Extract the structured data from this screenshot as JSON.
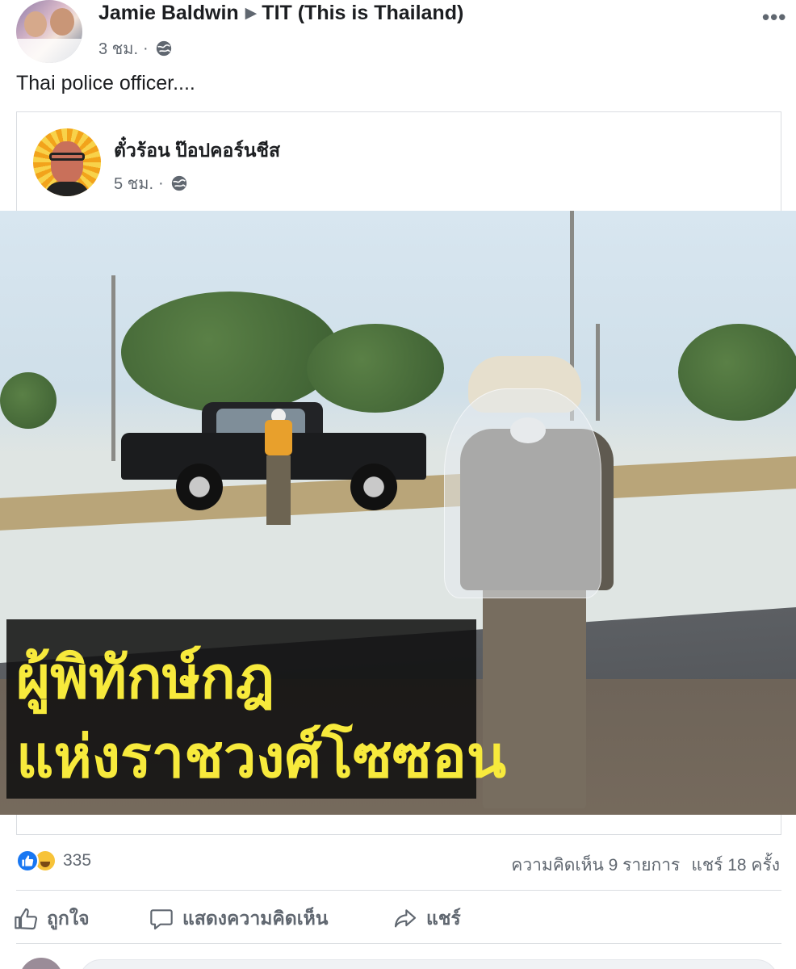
{
  "post": {
    "author": "Jamie Baldwin",
    "group": "TIT (This is Thailand)",
    "time": "3 ชม.",
    "separator": "·",
    "more_icon": "ellipsis-icon",
    "text": "Thai police officer...."
  },
  "shared": {
    "author": "ตั๋วร้อน ป๊อปคอร์นชีส",
    "time": "5 ชม.",
    "separator": "·",
    "image": {
      "caption_line1": "ผู้พิทักษ์กฎ",
      "caption_line2": "แห่งราชวงศ์โซซอน"
    }
  },
  "stats": {
    "reaction_count": "335",
    "comments": "ความคิดเห็น 9 รายการ",
    "shares": "แชร์ 18 ครั้ง"
  },
  "actions": {
    "like": "ถูกใจ",
    "comment": "แสดงความคิดเห็น",
    "share": "แชร์"
  },
  "colors": {
    "like_blue": "#1877f2",
    "muted_text": "#606770",
    "caption_yellow": "#f7ea3c"
  }
}
